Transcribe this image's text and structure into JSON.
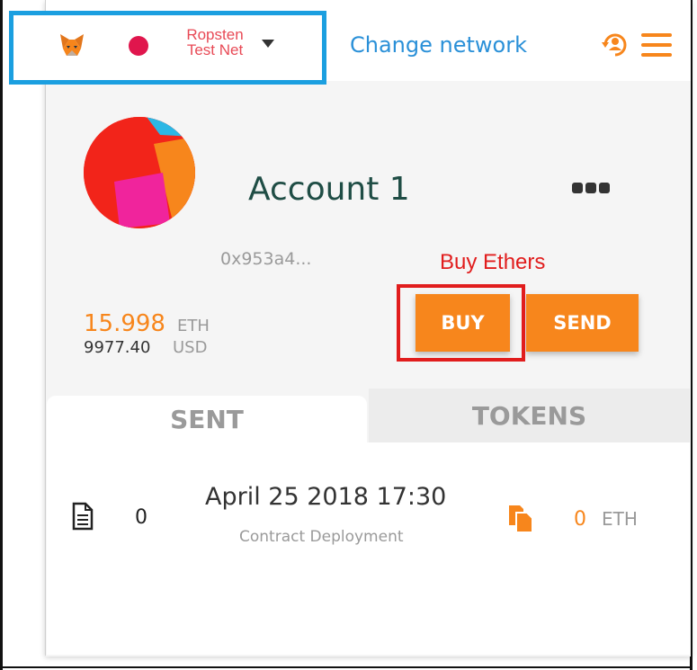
{
  "network": {
    "name_line1": "Ropsten",
    "name_line2": "Test Net"
  },
  "header": {
    "change_network": "Change network"
  },
  "account": {
    "name": "Account 1",
    "address": "0x953a4..."
  },
  "annotation": {
    "buy_label": "Buy Ethers"
  },
  "balance": {
    "eth_value": "15.998",
    "eth_unit": "ETH",
    "usd_value": "9977.40",
    "usd_unit": "USD"
  },
  "actions": {
    "buy": "BUY",
    "send": "SEND"
  },
  "tabs": [
    {
      "label": "SENT",
      "active": true
    },
    {
      "label": "TOKENS",
      "active": false
    }
  ],
  "transactions": [
    {
      "nonce": "0",
      "date": "April 25 2018 17:30",
      "type": "Contract Deployment",
      "value": "0",
      "unit": "ETH"
    }
  ],
  "colors": {
    "accent": "#f7861c",
    "link": "#2a90d8",
    "network": "#e0164d",
    "highlight_blue": "#1b9fe0",
    "highlight_red": "#e11d1d"
  },
  "icons": {
    "logo": "metamask-fox-icon",
    "sync": "account-sync-icon",
    "menu": "hamburger-menu-icon",
    "more": "more-options-icon",
    "doc": "document-icon",
    "copy": "copy-icon"
  }
}
